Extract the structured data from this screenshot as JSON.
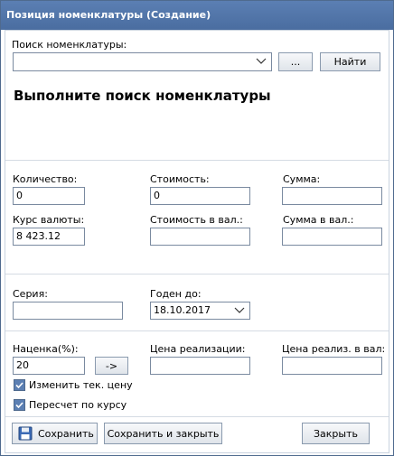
{
  "window": {
    "title": "Позиция номенклатуры (Создание)"
  },
  "search": {
    "label": "Поиск номенклатуры:",
    "value": "",
    "browse_label": "...",
    "find_label": "Найти"
  },
  "message": "Выполните поиск номенклатуры",
  "quantity": {
    "label": "Количество:",
    "value": "0"
  },
  "cost": {
    "label": "Стоимость:",
    "value": "0"
  },
  "sum": {
    "label": "Сумма:",
    "value": ""
  },
  "rate": {
    "label": "Курс валюты:",
    "value": "8 423.12"
  },
  "cost_cur": {
    "label": "Стоимость в вал.:",
    "value": ""
  },
  "sum_cur": {
    "label": "Сумма в вал.:",
    "value": ""
  },
  "series": {
    "label": "Серия:",
    "value": ""
  },
  "expiry": {
    "label": "Годен до:",
    "value": "18.10.2017"
  },
  "markup": {
    "label": "Наценка(%):",
    "value": "20",
    "apply_label": "->"
  },
  "sale_price": {
    "label": "Цена реализации:",
    "value": ""
  },
  "sale_price_cur": {
    "label": "Цена реализ. в вал:",
    "value": ""
  },
  "options": {
    "change_price": {
      "label": "Изменить тек. цену",
      "checked": true
    },
    "recalc_rate": {
      "label": "Пересчет по курсу",
      "checked": true
    }
  },
  "footer": {
    "save_label": "Сохранить",
    "save_close_label": "Сохранить и закрыть",
    "close_label": "Закрыть"
  },
  "colors": {
    "titlebar": "#4a6da0",
    "checkbox": "#5b7fb3"
  },
  "icons": {
    "save": "floppy-disk-icon",
    "dropdown": "chevron-down-icon",
    "check": "checkmark-icon"
  }
}
